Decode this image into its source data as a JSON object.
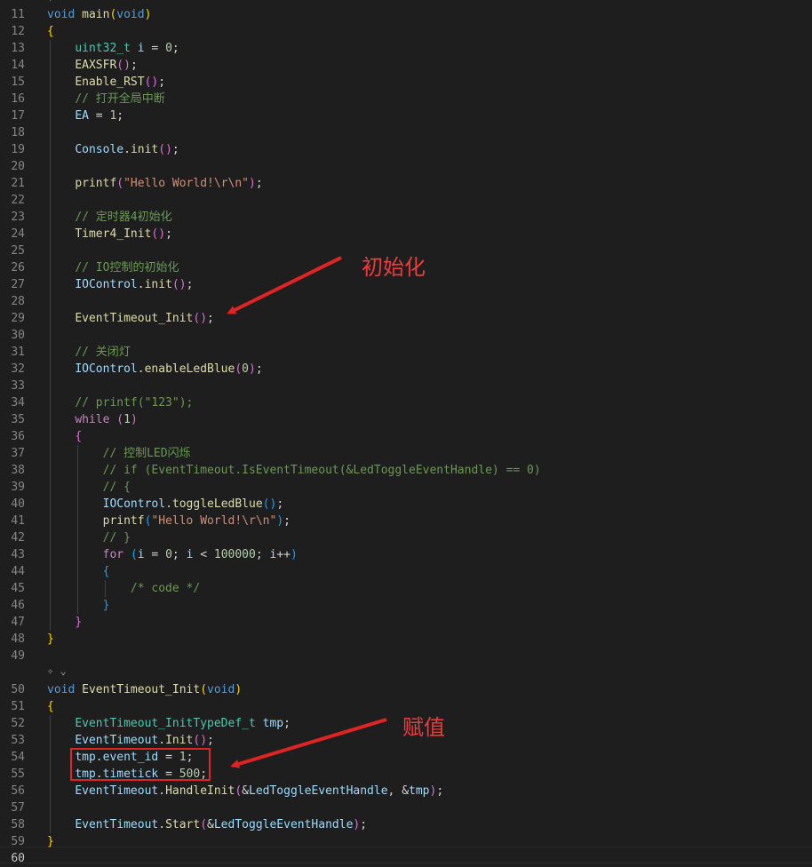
{
  "editor": {
    "codelens_icon": "sparkle-icon",
    "codelens_chevron": "chevron-down-icon",
    "active_line": "60",
    "lines": [
      {
        "n": "11",
        "tokens": [
          [
            "void",
            "tk-kw"
          ],
          [
            " ",
            "tk-p"
          ],
          [
            "main",
            "tk-fn"
          ],
          [
            "(",
            "tk-b1"
          ],
          [
            "void",
            "tk-kw"
          ],
          [
            ")",
            "tk-b1"
          ]
        ]
      },
      {
        "n": "12",
        "tokens": [
          [
            "{",
            "tk-b1"
          ]
        ]
      },
      {
        "n": "13",
        "tokens": [
          [
            "    ",
            "tk-p"
          ],
          [
            "uint32_t",
            "tk-ty"
          ],
          [
            " ",
            "tk-p"
          ],
          [
            "i",
            "tk-var"
          ],
          [
            " = ",
            "tk-p"
          ],
          [
            "0",
            "tk-num"
          ],
          [
            ";",
            "tk-p"
          ]
        ]
      },
      {
        "n": "14",
        "tokens": [
          [
            "    ",
            "tk-p"
          ],
          [
            "EAXSFR",
            "tk-fn"
          ],
          [
            "()",
            "tk-b2"
          ],
          [
            ";",
            "tk-p"
          ]
        ]
      },
      {
        "n": "15",
        "tokens": [
          [
            "    ",
            "tk-p"
          ],
          [
            "Enable_RST",
            "tk-fn"
          ],
          [
            "()",
            "tk-b2"
          ],
          [
            ";",
            "tk-p"
          ]
        ]
      },
      {
        "n": "16",
        "tokens": [
          [
            "    ",
            "tk-p"
          ],
          [
            "// 打开全局中断",
            "tk-com"
          ]
        ]
      },
      {
        "n": "17",
        "tokens": [
          [
            "    ",
            "tk-p"
          ],
          [
            "EA",
            "tk-var"
          ],
          [
            " = ",
            "tk-p"
          ],
          [
            "1",
            "tk-num"
          ],
          [
            ";",
            "tk-p"
          ]
        ]
      },
      {
        "n": "18",
        "tokens": []
      },
      {
        "n": "19",
        "tokens": [
          [
            "    ",
            "tk-p"
          ],
          [
            "Console",
            "tk-var"
          ],
          [
            ".",
            "tk-p"
          ],
          [
            "init",
            "tk-fn"
          ],
          [
            "()",
            "tk-b2"
          ],
          [
            ";",
            "tk-p"
          ]
        ]
      },
      {
        "n": "20",
        "tokens": []
      },
      {
        "n": "21",
        "tokens": [
          [
            "    ",
            "tk-p"
          ],
          [
            "printf",
            "tk-fn"
          ],
          [
            "(",
            "tk-b2"
          ],
          [
            "\"Hello World!\\r\\n\"",
            "tk-str"
          ],
          [
            ")",
            "tk-b2"
          ],
          [
            ";",
            "tk-p"
          ]
        ]
      },
      {
        "n": "22",
        "tokens": []
      },
      {
        "n": "23",
        "tokens": [
          [
            "    ",
            "tk-p"
          ],
          [
            "// 定时器4初始化",
            "tk-com"
          ]
        ]
      },
      {
        "n": "24",
        "tokens": [
          [
            "    ",
            "tk-p"
          ],
          [
            "Timer4_Init",
            "tk-fn"
          ],
          [
            "()",
            "tk-b2"
          ],
          [
            ";",
            "tk-p"
          ]
        ]
      },
      {
        "n": "25",
        "tokens": []
      },
      {
        "n": "26",
        "tokens": [
          [
            "    ",
            "tk-p"
          ],
          [
            "// IO控制的初始化",
            "tk-com"
          ]
        ]
      },
      {
        "n": "27",
        "tokens": [
          [
            "    ",
            "tk-p"
          ],
          [
            "IOControl",
            "tk-var"
          ],
          [
            ".",
            "tk-p"
          ],
          [
            "init",
            "tk-fn"
          ],
          [
            "()",
            "tk-b2"
          ],
          [
            ";",
            "tk-p"
          ]
        ]
      },
      {
        "n": "28",
        "tokens": []
      },
      {
        "n": "29",
        "tokens": [
          [
            "    ",
            "tk-p"
          ],
          [
            "EventTimeout_Init",
            "tk-fn"
          ],
          [
            "()",
            "tk-b2"
          ],
          [
            ";",
            "tk-p"
          ]
        ]
      },
      {
        "n": "30",
        "tokens": []
      },
      {
        "n": "31",
        "tokens": [
          [
            "    ",
            "tk-p"
          ],
          [
            "// 关闭灯",
            "tk-com"
          ]
        ]
      },
      {
        "n": "32",
        "tokens": [
          [
            "    ",
            "tk-p"
          ],
          [
            "IOControl",
            "tk-var"
          ],
          [
            ".",
            "tk-p"
          ],
          [
            "enableLedBlue",
            "tk-fn"
          ],
          [
            "(",
            "tk-b2"
          ],
          [
            "0",
            "tk-num"
          ],
          [
            ")",
            "tk-b2"
          ],
          [
            ";",
            "tk-p"
          ]
        ]
      },
      {
        "n": "33",
        "tokens": []
      },
      {
        "n": "34",
        "tokens": [
          [
            "    ",
            "tk-p"
          ],
          [
            "// printf(\"123\");",
            "tk-com"
          ]
        ]
      },
      {
        "n": "35",
        "tokens": [
          [
            "    ",
            "tk-p"
          ],
          [
            "while",
            "tk-ctl"
          ],
          [
            " ",
            "tk-p"
          ],
          [
            "(",
            "tk-b2"
          ],
          [
            "1",
            "tk-num"
          ],
          [
            ")",
            "tk-b2"
          ]
        ]
      },
      {
        "n": "36",
        "tokens": [
          [
            "    ",
            "tk-p"
          ],
          [
            "{",
            "tk-b2"
          ]
        ]
      },
      {
        "n": "37",
        "tokens": [
          [
            "        ",
            "tk-p"
          ],
          [
            "// 控制LED闪烁",
            "tk-com"
          ]
        ]
      },
      {
        "n": "38",
        "tokens": [
          [
            "        ",
            "tk-p"
          ],
          [
            "// if (EventTimeout.IsEventTimeout(&LedToggleEventHandle) == 0)",
            "tk-com"
          ]
        ]
      },
      {
        "n": "39",
        "tokens": [
          [
            "        ",
            "tk-p"
          ],
          [
            "// {",
            "tk-com"
          ]
        ]
      },
      {
        "n": "40",
        "tokens": [
          [
            "        ",
            "tk-p"
          ],
          [
            "IOControl",
            "tk-var"
          ],
          [
            ".",
            "tk-p"
          ],
          [
            "toggleLedBlue",
            "tk-fn"
          ],
          [
            "()",
            "tk-b3"
          ],
          [
            ";",
            "tk-p"
          ]
        ]
      },
      {
        "n": "41",
        "tokens": [
          [
            "        ",
            "tk-p"
          ],
          [
            "printf",
            "tk-fn"
          ],
          [
            "(",
            "tk-b3"
          ],
          [
            "\"Hello World!\\r\\n\"",
            "tk-str"
          ],
          [
            ")",
            "tk-b3"
          ],
          [
            ";",
            "tk-p"
          ]
        ]
      },
      {
        "n": "42",
        "tokens": [
          [
            "        ",
            "tk-p"
          ],
          [
            "// }",
            "tk-com"
          ]
        ]
      },
      {
        "n": "43",
        "tokens": [
          [
            "        ",
            "tk-p"
          ],
          [
            "for",
            "tk-ctl"
          ],
          [
            " ",
            "tk-p"
          ],
          [
            "(",
            "tk-b3"
          ],
          [
            "i",
            "tk-var"
          ],
          [
            " = ",
            "tk-p"
          ],
          [
            "0",
            "tk-num"
          ],
          [
            "; ",
            "tk-p"
          ],
          [
            "i",
            "tk-var"
          ],
          [
            " < ",
            "tk-p"
          ],
          [
            "100000",
            "tk-num"
          ],
          [
            "; ",
            "tk-p"
          ],
          [
            "i",
            "tk-var"
          ],
          [
            "++",
            "tk-p"
          ],
          [
            ")",
            "tk-b3"
          ]
        ]
      },
      {
        "n": "44",
        "tokens": [
          [
            "        ",
            "tk-p"
          ],
          [
            "{",
            "tk-b3"
          ]
        ]
      },
      {
        "n": "45",
        "tokens": [
          [
            "            ",
            "tk-p"
          ],
          [
            "/* code */",
            "tk-com"
          ]
        ]
      },
      {
        "n": "46",
        "tokens": [
          [
            "        ",
            "tk-p"
          ],
          [
            "}",
            "tk-b3"
          ]
        ]
      },
      {
        "n": "47",
        "tokens": [
          [
            "    ",
            "tk-p"
          ],
          [
            "}",
            "tk-b2"
          ]
        ]
      },
      {
        "n": "48",
        "tokens": [
          [
            "}",
            "tk-b1"
          ]
        ]
      },
      {
        "n": "49",
        "tokens": []
      },
      {
        "n": "50",
        "tokens": [
          [
            "void",
            "tk-kw"
          ],
          [
            " ",
            "tk-p"
          ],
          [
            "EventTimeout_Init",
            "tk-fn"
          ],
          [
            "(",
            "tk-b1"
          ],
          [
            "void",
            "tk-kw"
          ],
          [
            ")",
            "tk-b1"
          ]
        ]
      },
      {
        "n": "51",
        "tokens": [
          [
            "{",
            "tk-b1"
          ]
        ]
      },
      {
        "n": "52",
        "tokens": [
          [
            "    ",
            "tk-p"
          ],
          [
            "EventTimeout_InitTypeDef_t",
            "tk-ty"
          ],
          [
            " ",
            "tk-p"
          ],
          [
            "tmp",
            "tk-var"
          ],
          [
            ";",
            "tk-p"
          ]
        ]
      },
      {
        "n": "53",
        "tokens": [
          [
            "    ",
            "tk-p"
          ],
          [
            "EventTimeout",
            "tk-var"
          ],
          [
            ".",
            "tk-p"
          ],
          [
            "Init",
            "tk-fn"
          ],
          [
            "()",
            "tk-b2"
          ],
          [
            ";",
            "tk-p"
          ]
        ]
      },
      {
        "n": "54",
        "tokens": [
          [
            "    ",
            "tk-p"
          ],
          [
            "tmp",
            "tk-var"
          ],
          [
            ".",
            "tk-p"
          ],
          [
            "event_id",
            "tk-var"
          ],
          [
            " = ",
            "tk-p"
          ],
          [
            "1",
            "tk-num"
          ],
          [
            ";",
            "tk-p"
          ]
        ]
      },
      {
        "n": "55",
        "tokens": [
          [
            "    ",
            "tk-p"
          ],
          [
            "tmp",
            "tk-var"
          ],
          [
            ".",
            "tk-p"
          ],
          [
            "timetick",
            "tk-var"
          ],
          [
            " = ",
            "tk-p"
          ],
          [
            "500",
            "tk-num"
          ],
          [
            ";",
            "tk-p"
          ]
        ]
      },
      {
        "n": "56",
        "tokens": [
          [
            "    ",
            "tk-p"
          ],
          [
            "EventTimeout",
            "tk-var"
          ],
          [
            ".",
            "tk-p"
          ],
          [
            "HandleInit",
            "tk-fn"
          ],
          [
            "(",
            "tk-b2"
          ],
          [
            "&",
            "tk-p"
          ],
          [
            "LedToggleEventHandle",
            "tk-var"
          ],
          [
            ", &",
            "tk-p"
          ],
          [
            "tmp",
            "tk-var"
          ],
          [
            ")",
            "tk-b2"
          ],
          [
            ";",
            "tk-p"
          ]
        ]
      },
      {
        "n": "57",
        "tokens": []
      },
      {
        "n": "58",
        "tokens": [
          [
            "    ",
            "tk-p"
          ],
          [
            "EventTimeout",
            "tk-var"
          ],
          [
            ".",
            "tk-p"
          ],
          [
            "Start",
            "tk-fn"
          ],
          [
            "(",
            "tk-b2"
          ],
          [
            "&",
            "tk-p"
          ],
          [
            "LedToggleEventHandle",
            "tk-var"
          ],
          [
            ")",
            "tk-b2"
          ],
          [
            ";",
            "tk-p"
          ]
        ]
      },
      {
        "n": "59",
        "tokens": [
          [
            "}",
            "tk-b1"
          ]
        ]
      },
      {
        "n": "60",
        "tokens": []
      }
    ]
  },
  "annotations": {
    "init_label": "初始化",
    "assign_label": "赋值",
    "color": "#ef3b3b"
  }
}
